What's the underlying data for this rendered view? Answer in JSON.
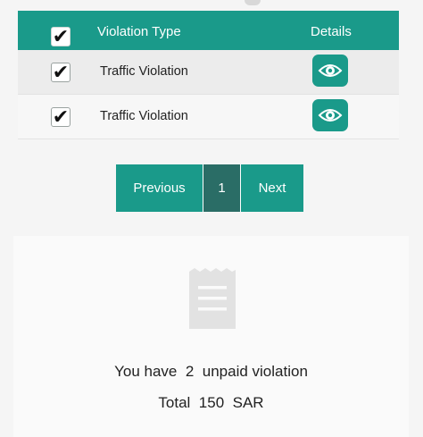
{
  "table": {
    "header": {
      "select_all_checked": "✔",
      "col_type": "Violation Type",
      "col_details": "Details"
    },
    "rows": [
      {
        "check": "✔",
        "type": "Traffic Violation"
      },
      {
        "check": "✔",
        "type": "Traffic Violation"
      }
    ]
  },
  "pagination": {
    "previous": "Previous",
    "current": "1",
    "next": "Next"
  },
  "summary": {
    "prefix": "You have",
    "count": "2",
    "suffix": "unpaid violation",
    "total_label": "Total",
    "total_value": "150",
    "currency": "SAR"
  },
  "colors": {
    "accent": "#1a9a8a",
    "active_page": "#2a6d66"
  },
  "icons": {
    "details": "eye-icon",
    "summary": "receipt-icon"
  }
}
